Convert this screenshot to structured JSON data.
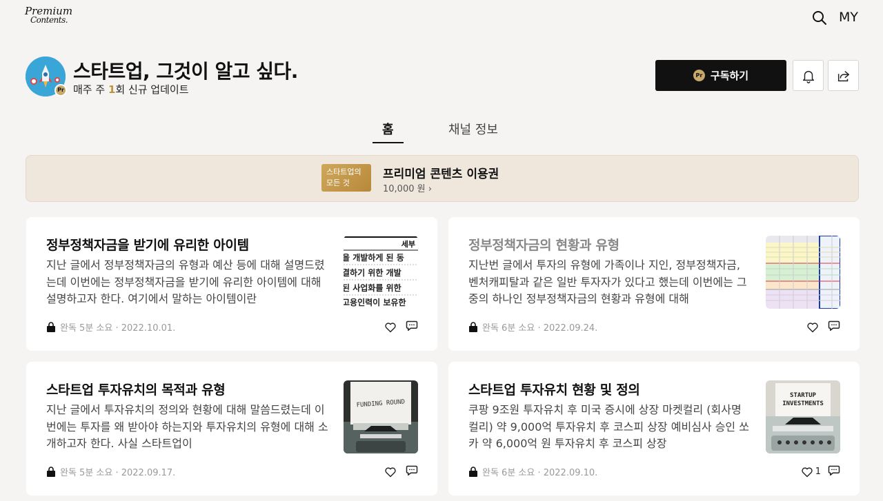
{
  "header": {
    "logo_line1": "Premium",
    "logo_line2": "Contents.",
    "my_label": "MY"
  },
  "channel": {
    "title": "스타트업, 그것이 알고 싶다.",
    "sub_prefix": "매주 주 ",
    "sub_count": "1",
    "sub_suffix": "회 신규 업데이트",
    "badge": "Pr",
    "subscribe_badge": "Pr",
    "subscribe_label": "구독하기"
  },
  "tabs": [
    {
      "label": "홈",
      "active": true
    },
    {
      "label": "채널 정보",
      "active": false
    }
  ],
  "banner": {
    "thumb_text_1": "스타트업의",
    "thumb_text_2": "모든 것",
    "title": "프리미엄 콘텐츠 이용권",
    "price": "10,000 원 ›"
  },
  "posts": [
    {
      "title": "정부정책자금을 받기에 유리한 아이템",
      "excerpt": "지난 글에서 정부정책자금의 유형과 예산 등에 대해 설명드렸는데 이번에는 정부정책자금을 받기에 유리한 아이템에 대해 설명하고자 한다. 여기에서 말하는 아이템이란",
      "meta": "완독 5분 소요 · 2022.10.01.",
      "likes": "",
      "read": false,
      "thumb_lines": [
        "세부",
        "을 개발하게 된 동",
        "결하기 위한 개발",
        "된 사업화를 위한",
        "고용인력이 보유한"
      ]
    },
    {
      "title": "정부정책자금의 현황과 유형",
      "excerpt": "지난번 글에서 투자의 유형에 가족이나 지인, 정부정책자금, 벤처캐피탈과 같은 일반 투자자가 있다고 했는데 이번에는 그중의 하나인 정부정책자금의 현황과 유형에 대해",
      "meta": "완독 6분 소요 · 2022.09.24.",
      "likes": "",
      "read": true
    },
    {
      "title": "스타트업 투자유치의 목적과 유형",
      "excerpt": "지난 글에서 투자유치의 정의와 현황에 대해 말씀드렸는데 이번에는 투자를 왜 받아야 하는지와 투자유치의 유형에 대해 소개하고자 한다. 사실 스타트업이",
      "meta": "완독 5분 소요 · 2022.09.17.",
      "likes": "",
      "read": false,
      "thumb_caption": "FUNDING ROUND"
    },
    {
      "title": "스타트업 투자유치 현황 및 정의",
      "excerpt": "쿠팡 9조원 투자유치 후 미국 증시에 상장 마켓컬리 (회사명 컬리) 약 9,000억 투자유치 후 코스피 상장 예비심사 승인 쏘카 약 6,000억 원 투자유치 후 코스피 상장",
      "meta": "완독 6분 소요 · 2022.09.10.",
      "likes": "1",
      "read": false,
      "thumb_caption_1": "STARTUP",
      "thumb_caption_2": "INVESTMENTS"
    }
  ],
  "colors": {
    "background": "#f5f4f3",
    "accent_gold": "#c9a86b",
    "banner_bg": "#efe7dc",
    "primary_button": "#111111"
  },
  "icons": {
    "search": "search-icon",
    "bell": "bell-icon",
    "share": "share-icon",
    "lock": "lock-icon",
    "heart": "heart-icon",
    "comment": "comment-icon"
  }
}
